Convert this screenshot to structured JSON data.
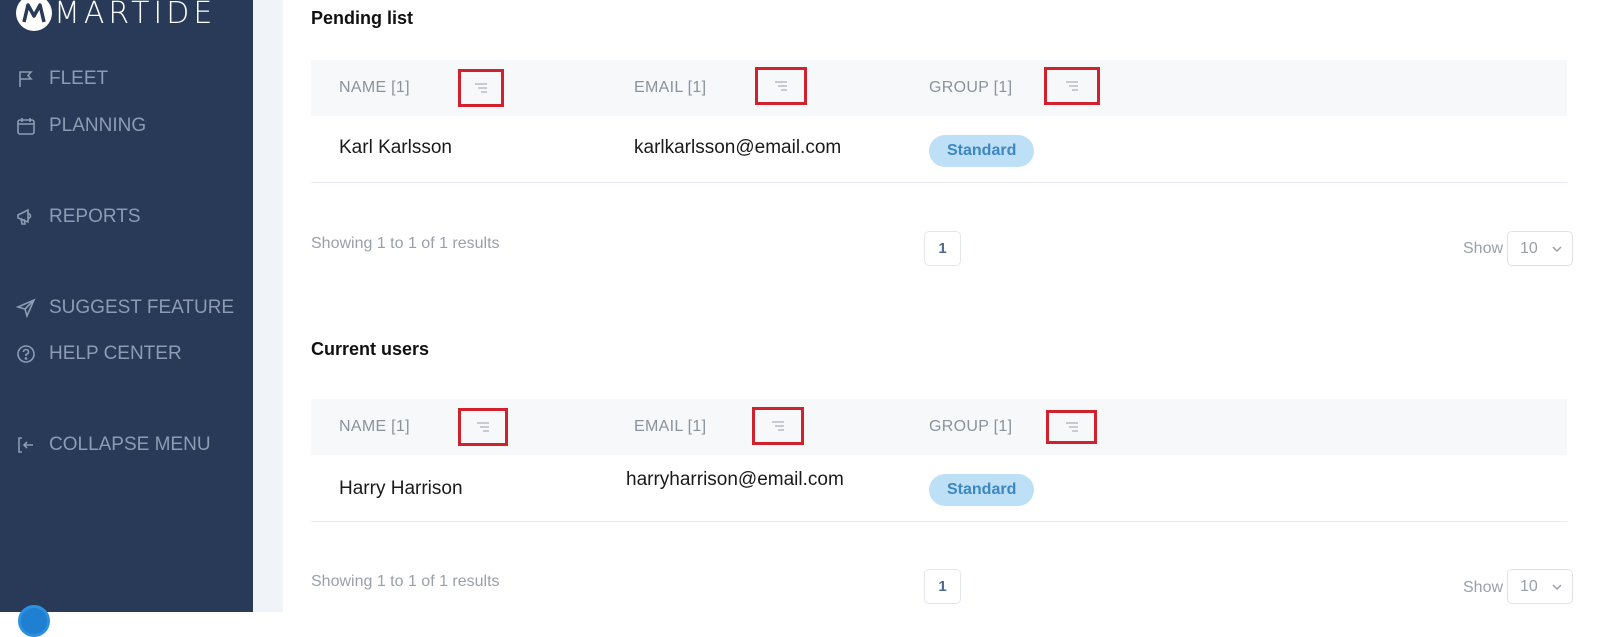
{
  "app": {
    "brand": "MARTIDE"
  },
  "sidebar": {
    "items": [
      {
        "label": "FLEET",
        "icon": "flag-icon"
      },
      {
        "label": "PLANNING",
        "icon": "calendar-icon"
      },
      {
        "label": "REPORTS",
        "icon": "megaphone-icon"
      },
      {
        "label": "SUGGEST FEATURE",
        "icon": "send-icon"
      },
      {
        "label": "HELP CENTER",
        "icon": "help-circle-icon"
      },
      {
        "label": "COLLAPSE MENU",
        "icon": "collapse-icon"
      }
    ]
  },
  "pending": {
    "title": "Pending list",
    "columns": [
      "NAME [1]",
      "EMAIL [1]",
      "GROUP [1]"
    ],
    "rows": [
      {
        "name": "Karl Karlsson",
        "email": "karlkarlsson@email.com",
        "group": "Standard"
      }
    ],
    "summary": "Showing 1 to 1 of 1 results",
    "page": "1",
    "show_label": "Show",
    "page_size": "10"
  },
  "current": {
    "title": "Current users",
    "columns": [
      "NAME [1]",
      "EMAIL [1]",
      "GROUP [1]"
    ],
    "rows": [
      {
        "name": "Harry Harrison",
        "email": "harryharrison@email.com",
        "group": "Standard"
      }
    ],
    "summary": "Showing 1 to 1 of 1 results",
    "page": "1",
    "show_label": "Show",
    "page_size": "10"
  }
}
